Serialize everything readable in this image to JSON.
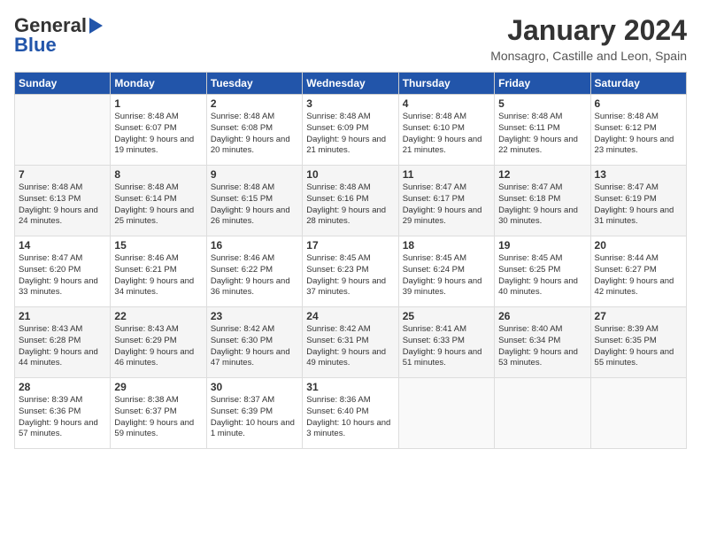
{
  "header": {
    "logo_general": "General",
    "logo_blue": "Blue",
    "month_title": "January 2024",
    "location": "Monsagro, Castille and Leon, Spain"
  },
  "weekdays": [
    "Sunday",
    "Monday",
    "Tuesday",
    "Wednesday",
    "Thursday",
    "Friday",
    "Saturday"
  ],
  "weeks": [
    [
      {
        "day": "",
        "sunrise": "",
        "sunset": "",
        "daylight": ""
      },
      {
        "day": "1",
        "sunrise": "Sunrise: 8:48 AM",
        "sunset": "Sunset: 6:07 PM",
        "daylight": "Daylight: 9 hours and 19 minutes."
      },
      {
        "day": "2",
        "sunrise": "Sunrise: 8:48 AM",
        "sunset": "Sunset: 6:08 PM",
        "daylight": "Daylight: 9 hours and 20 minutes."
      },
      {
        "day": "3",
        "sunrise": "Sunrise: 8:48 AM",
        "sunset": "Sunset: 6:09 PM",
        "daylight": "Daylight: 9 hours and 21 minutes."
      },
      {
        "day": "4",
        "sunrise": "Sunrise: 8:48 AM",
        "sunset": "Sunset: 6:10 PM",
        "daylight": "Daylight: 9 hours and 21 minutes."
      },
      {
        "day": "5",
        "sunrise": "Sunrise: 8:48 AM",
        "sunset": "Sunset: 6:11 PM",
        "daylight": "Daylight: 9 hours and 22 minutes."
      },
      {
        "day": "6",
        "sunrise": "Sunrise: 8:48 AM",
        "sunset": "Sunset: 6:12 PM",
        "daylight": "Daylight: 9 hours and 23 minutes."
      }
    ],
    [
      {
        "day": "7",
        "sunrise": "Sunrise: 8:48 AM",
        "sunset": "Sunset: 6:13 PM",
        "daylight": "Daylight: 9 hours and 24 minutes."
      },
      {
        "day": "8",
        "sunrise": "Sunrise: 8:48 AM",
        "sunset": "Sunset: 6:14 PM",
        "daylight": "Daylight: 9 hours and 25 minutes."
      },
      {
        "day": "9",
        "sunrise": "Sunrise: 8:48 AM",
        "sunset": "Sunset: 6:15 PM",
        "daylight": "Daylight: 9 hours and 26 minutes."
      },
      {
        "day": "10",
        "sunrise": "Sunrise: 8:48 AM",
        "sunset": "Sunset: 6:16 PM",
        "daylight": "Daylight: 9 hours and 28 minutes."
      },
      {
        "day": "11",
        "sunrise": "Sunrise: 8:47 AM",
        "sunset": "Sunset: 6:17 PM",
        "daylight": "Daylight: 9 hours and 29 minutes."
      },
      {
        "day": "12",
        "sunrise": "Sunrise: 8:47 AM",
        "sunset": "Sunset: 6:18 PM",
        "daylight": "Daylight: 9 hours and 30 minutes."
      },
      {
        "day": "13",
        "sunrise": "Sunrise: 8:47 AM",
        "sunset": "Sunset: 6:19 PM",
        "daylight": "Daylight: 9 hours and 31 minutes."
      }
    ],
    [
      {
        "day": "14",
        "sunrise": "Sunrise: 8:47 AM",
        "sunset": "Sunset: 6:20 PM",
        "daylight": "Daylight: 9 hours and 33 minutes."
      },
      {
        "day": "15",
        "sunrise": "Sunrise: 8:46 AM",
        "sunset": "Sunset: 6:21 PM",
        "daylight": "Daylight: 9 hours and 34 minutes."
      },
      {
        "day": "16",
        "sunrise": "Sunrise: 8:46 AM",
        "sunset": "Sunset: 6:22 PM",
        "daylight": "Daylight: 9 hours and 36 minutes."
      },
      {
        "day": "17",
        "sunrise": "Sunrise: 8:45 AM",
        "sunset": "Sunset: 6:23 PM",
        "daylight": "Daylight: 9 hours and 37 minutes."
      },
      {
        "day": "18",
        "sunrise": "Sunrise: 8:45 AM",
        "sunset": "Sunset: 6:24 PM",
        "daylight": "Daylight: 9 hours and 39 minutes."
      },
      {
        "day": "19",
        "sunrise": "Sunrise: 8:45 AM",
        "sunset": "Sunset: 6:25 PM",
        "daylight": "Daylight: 9 hours and 40 minutes."
      },
      {
        "day": "20",
        "sunrise": "Sunrise: 8:44 AM",
        "sunset": "Sunset: 6:27 PM",
        "daylight": "Daylight: 9 hours and 42 minutes."
      }
    ],
    [
      {
        "day": "21",
        "sunrise": "Sunrise: 8:43 AM",
        "sunset": "Sunset: 6:28 PM",
        "daylight": "Daylight: 9 hours and 44 minutes."
      },
      {
        "day": "22",
        "sunrise": "Sunrise: 8:43 AM",
        "sunset": "Sunset: 6:29 PM",
        "daylight": "Daylight: 9 hours and 46 minutes."
      },
      {
        "day": "23",
        "sunrise": "Sunrise: 8:42 AM",
        "sunset": "Sunset: 6:30 PM",
        "daylight": "Daylight: 9 hours and 47 minutes."
      },
      {
        "day": "24",
        "sunrise": "Sunrise: 8:42 AM",
        "sunset": "Sunset: 6:31 PM",
        "daylight": "Daylight: 9 hours and 49 minutes."
      },
      {
        "day": "25",
        "sunrise": "Sunrise: 8:41 AM",
        "sunset": "Sunset: 6:33 PM",
        "daylight": "Daylight: 9 hours and 51 minutes."
      },
      {
        "day": "26",
        "sunrise": "Sunrise: 8:40 AM",
        "sunset": "Sunset: 6:34 PM",
        "daylight": "Daylight: 9 hours and 53 minutes."
      },
      {
        "day": "27",
        "sunrise": "Sunrise: 8:39 AM",
        "sunset": "Sunset: 6:35 PM",
        "daylight": "Daylight: 9 hours and 55 minutes."
      }
    ],
    [
      {
        "day": "28",
        "sunrise": "Sunrise: 8:39 AM",
        "sunset": "Sunset: 6:36 PM",
        "daylight": "Daylight: 9 hours and 57 minutes."
      },
      {
        "day": "29",
        "sunrise": "Sunrise: 8:38 AM",
        "sunset": "Sunset: 6:37 PM",
        "daylight": "Daylight: 9 hours and 59 minutes."
      },
      {
        "day": "30",
        "sunrise": "Sunrise: 8:37 AM",
        "sunset": "Sunset: 6:39 PM",
        "daylight": "Daylight: 10 hours and 1 minute."
      },
      {
        "day": "31",
        "sunrise": "Sunrise: 8:36 AM",
        "sunset": "Sunset: 6:40 PM",
        "daylight": "Daylight: 10 hours and 3 minutes."
      },
      {
        "day": "",
        "sunrise": "",
        "sunset": "",
        "daylight": ""
      },
      {
        "day": "",
        "sunrise": "",
        "sunset": "",
        "daylight": ""
      },
      {
        "day": "",
        "sunrise": "",
        "sunset": "",
        "daylight": ""
      }
    ]
  ]
}
